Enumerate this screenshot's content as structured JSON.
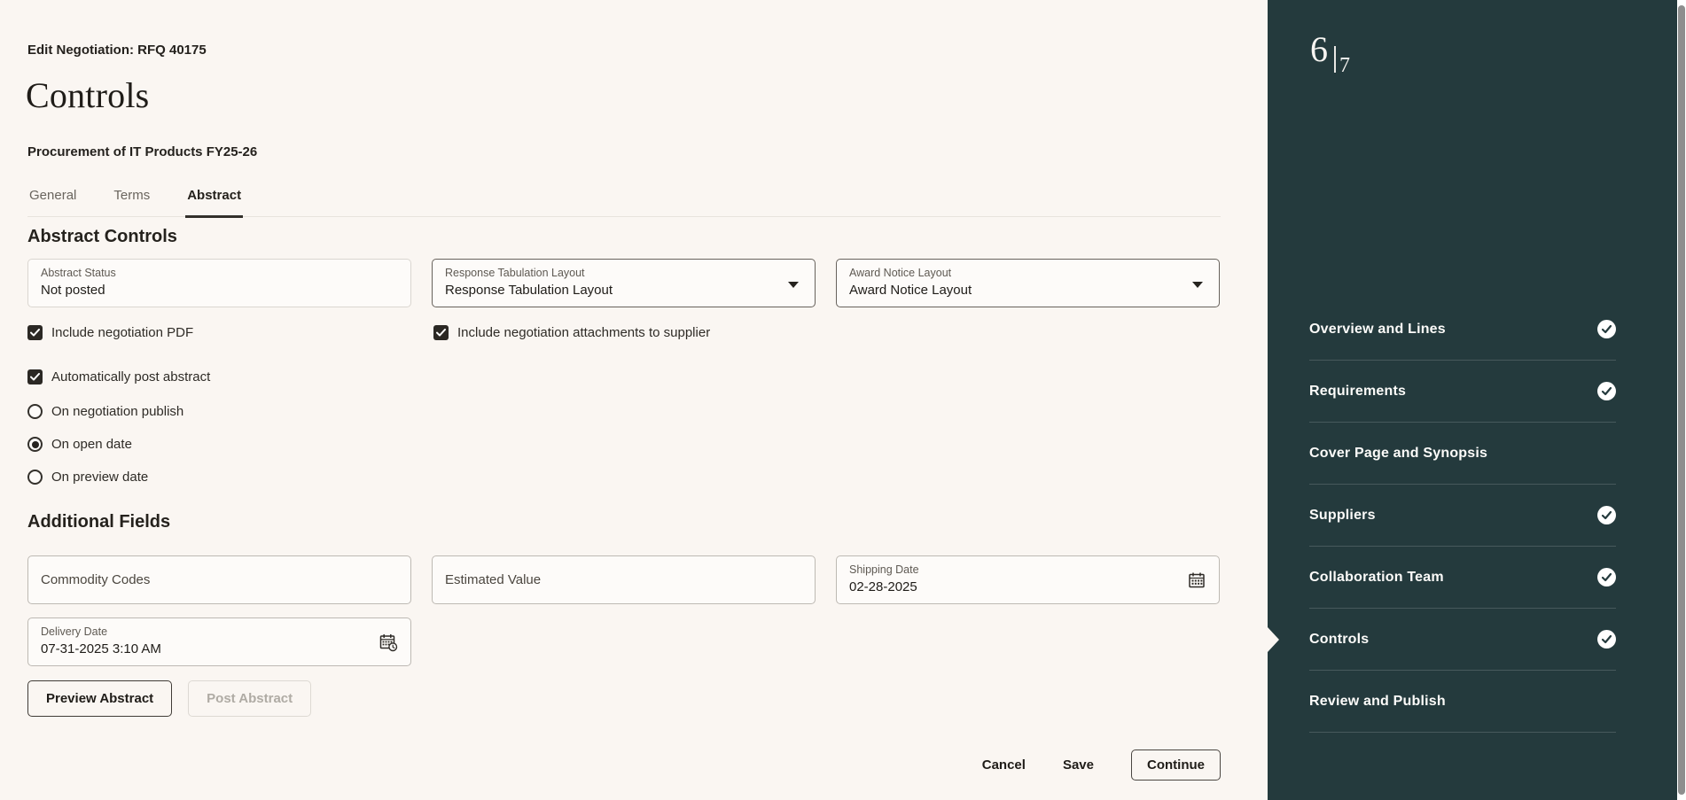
{
  "page": {
    "breadcrumb": "Edit Negotiation: RFQ 40175",
    "title": "Controls",
    "subtitle": "Procurement of IT Products FY25-26"
  },
  "tabs": [
    {
      "label": "General",
      "active": false
    },
    {
      "label": "Terms",
      "active": false
    },
    {
      "label": "Abstract",
      "active": true
    }
  ],
  "abstract_controls": {
    "heading": "Abstract Controls",
    "abstract_status": {
      "label": "Abstract Status",
      "value": "Not posted"
    },
    "response_tabulation_layout": {
      "label": "Response Tabulation Layout",
      "value": "Response Tabulation Layout"
    },
    "award_notice_layout": {
      "label": "Award Notice Layout",
      "value": "Award Notice Layout"
    },
    "checkbox_include_pdf": {
      "label": "Include negotiation PDF",
      "checked": true
    },
    "checkbox_include_attachments": {
      "label": "Include negotiation attachments to supplier",
      "checked": true
    },
    "checkbox_auto_post": {
      "label": "Automatically post abstract",
      "checked": true
    },
    "radios": [
      {
        "label": "On negotiation publish",
        "selected": false
      },
      {
        "label": "On open date",
        "selected": true
      },
      {
        "label": "On preview date",
        "selected": false
      }
    ]
  },
  "additional_fields": {
    "heading": "Additional Fields",
    "commodity_codes": {
      "label": "Commodity Codes",
      "value": ""
    },
    "estimated_value": {
      "label": "Estimated Value",
      "value": ""
    },
    "shipping_date": {
      "label": "Shipping Date",
      "value": "02-28-2025"
    },
    "delivery_date": {
      "label": "Delivery Date",
      "value": "07-31-2025 3:10 AM"
    }
  },
  "actions": {
    "preview_abstract": "Preview Abstract",
    "post_abstract": "Post Abstract"
  },
  "footer": {
    "cancel": "Cancel",
    "save": "Save",
    "continue": "Continue"
  },
  "sidebar": {
    "progress": {
      "current": "6",
      "total": "7"
    },
    "steps": [
      {
        "label": "Overview and Lines",
        "completed": true,
        "active": false
      },
      {
        "label": "Requirements",
        "completed": true,
        "active": false
      },
      {
        "label": "Cover Page and Synopsis",
        "completed": false,
        "active": false
      },
      {
        "label": "Suppliers",
        "completed": true,
        "active": false
      },
      {
        "label": "Collaboration Team",
        "completed": true,
        "active": false
      },
      {
        "label": "Controls",
        "completed": true,
        "active": true
      },
      {
        "label": "Review and Publish",
        "completed": false,
        "active": false
      }
    ]
  },
  "colors": {
    "main_background": "#FAF6F2",
    "sidebar_background": "#243A3D",
    "text_primary": "#1F1C18",
    "label_gray": "#5E5952",
    "checkbox_fill": "#2B2824",
    "sidebar_text": "#FCFBF9",
    "scrollbar_thumb": "#8E8E8E"
  }
}
